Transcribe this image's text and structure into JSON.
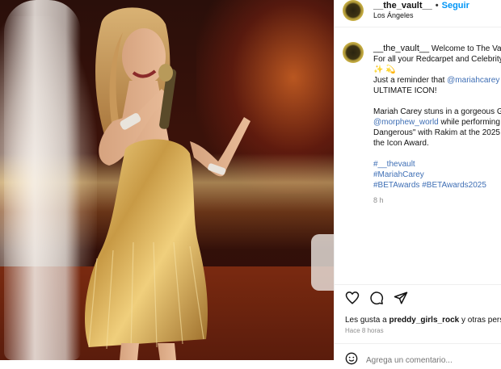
{
  "post": {
    "username": "__the_vault__",
    "follow_label": "Seguir",
    "separator": "•",
    "location": "Los Ángeles",
    "caption": {
      "line1": "Welcome to The Vault",
      "line2": "For all your Redcarpet and Celebrity",
      "line3": "✨ 💫",
      "line4_pre": "Just a reminder that ",
      "line4_mention": "@mariahcarey",
      "line5": "ULTIMATE ICON!",
      "line6": "Mariah Carey stuns in a gorgeous G",
      "line7_mention": "@morphew_world",
      "line7_post": " while performing",
      "line8": "Dangerous\" with Rakim at the 2025",
      "line9": "the Icon Award.",
      "tag1": "#__thevault",
      "tag2": "#MariahCarey",
      "tag3": "#BETAwards",
      "tag4": "#BETAwards2025"
    },
    "caption_time": "8 h",
    "likes_prefix": "Les gusta a ",
    "likes_user": "preddy_girls_rock",
    "likes_suffix": " y otras perso",
    "posted_ago": "Hace 8 horas",
    "comment_placeholder": "Agrega un comentario..."
  },
  "icons": {
    "like": "heart-icon",
    "comment": "comment-icon",
    "share": "share-icon",
    "emoji": "emoji-icon"
  },
  "colors": {
    "link": "#0095f6",
    "mention": "#3f6fb5",
    "muted": "#8e8e8e"
  }
}
